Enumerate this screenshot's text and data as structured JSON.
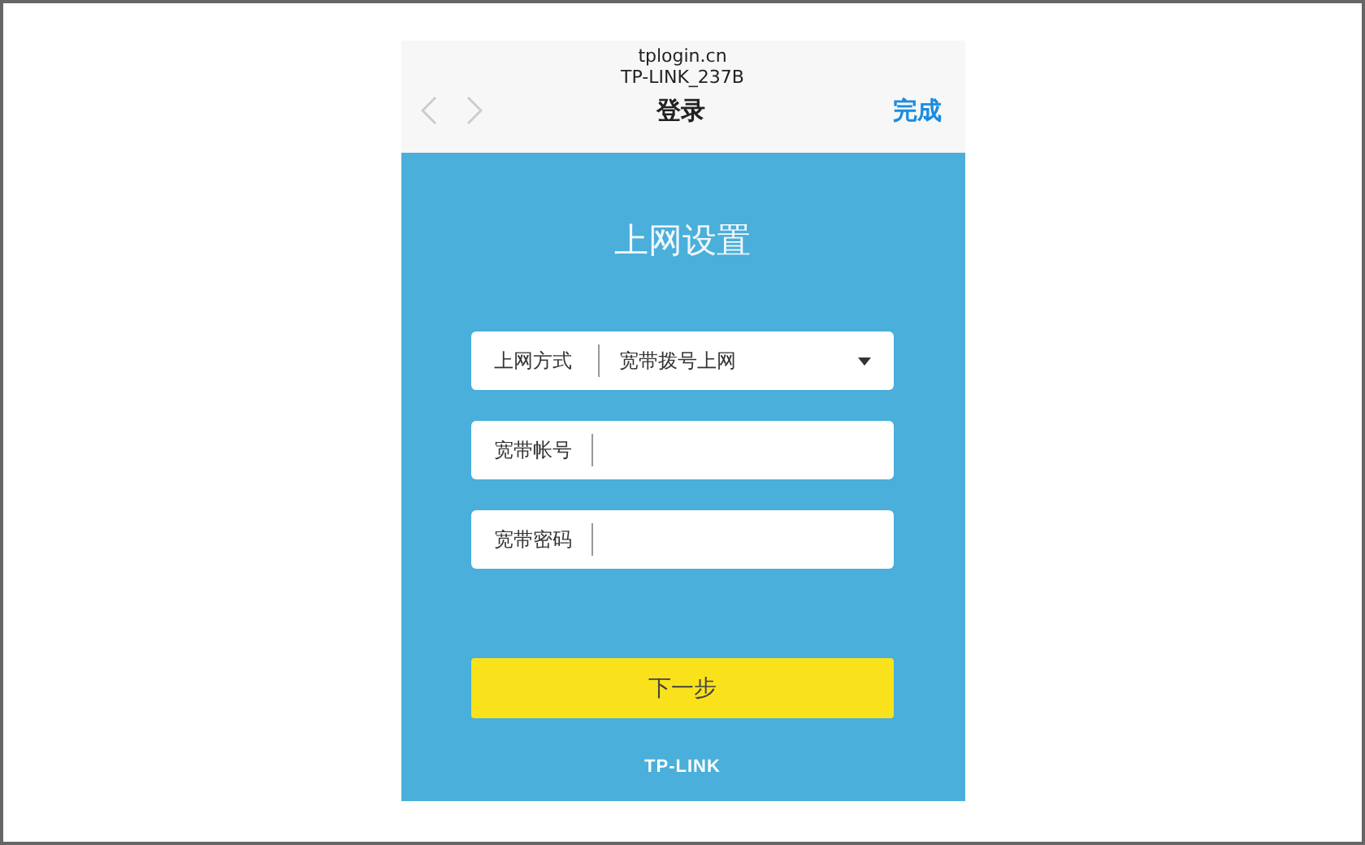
{
  "browser": {
    "url": "tplogin.cn",
    "network": "TP-LINK_237B",
    "title": "登录",
    "done": "完成"
  },
  "form": {
    "heading": "上网设置",
    "fields": [
      {
        "kind": "select",
        "label": "上网方式",
        "value": "宽带拨号上网"
      },
      {
        "kind": "input",
        "label": "宽带帐号"
      },
      {
        "kind": "input",
        "label": "宽带密码"
      }
    ],
    "next": "下一步"
  },
  "brand": "TP-LINK"
}
